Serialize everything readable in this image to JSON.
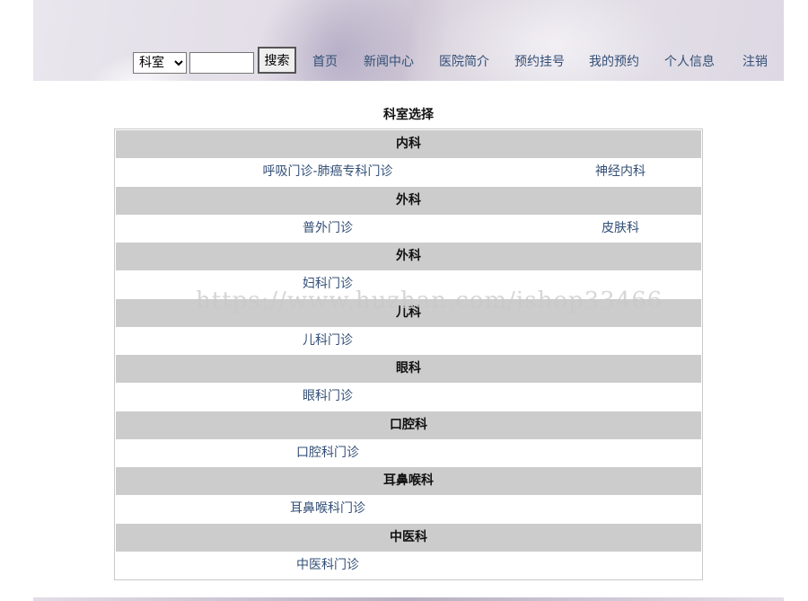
{
  "header": {
    "search": {
      "select_value": "科室",
      "input_value": "",
      "button_label": "搜索"
    },
    "nav": [
      "首页",
      "新闻中心",
      "医院简介",
      "预约挂号",
      "我的预约",
      "个人信息",
      "注销"
    ]
  },
  "panel": {
    "title": "科室选择",
    "categories": [
      {
        "name": "内科",
        "items": [
          "呼吸门诊-肺癌专科门诊",
          "神经内科"
        ]
      },
      {
        "name": "外科",
        "items": [
          "普外门诊",
          "皮肤科"
        ]
      },
      {
        "name": "外科",
        "items": [
          "妇科门诊"
        ]
      },
      {
        "name": "儿科",
        "items": [
          "儿科门诊"
        ]
      },
      {
        "name": "眼科",
        "items": [
          "眼科门诊"
        ]
      },
      {
        "name": "口腔科",
        "items": [
          "口腔科门诊"
        ]
      },
      {
        "name": "耳鼻喉科",
        "items": [
          "耳鼻喉科门诊"
        ]
      },
      {
        "name": "中医科",
        "items": [
          "中医科门诊"
        ]
      }
    ]
  },
  "watermark": "https://www.huzhan.com/ishop33466"
}
